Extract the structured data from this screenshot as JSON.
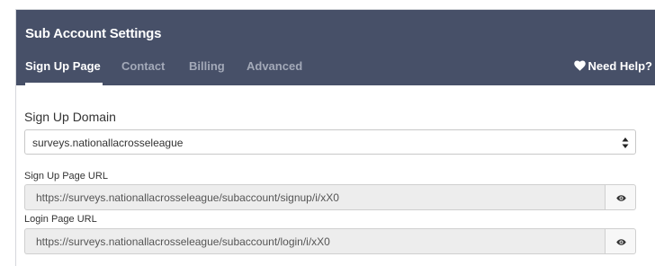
{
  "panel": {
    "title": "Sub Account Settings",
    "tabs": [
      {
        "label": "Sign Up Page",
        "active": true
      },
      {
        "label": "Contact",
        "active": false
      },
      {
        "label": "Billing",
        "active": false
      },
      {
        "label": "Advanced",
        "active": false
      }
    ],
    "help_label": "Need Help?",
    "help_icon": "heart-icon",
    "header_color": "#475068"
  },
  "signup_domain": {
    "label": "Sign Up Domain",
    "selected": "surveys.nationallacrosseleague"
  },
  "signup_url": {
    "label": "Sign Up Page URL",
    "value": "https://surveys.nationallacrosseleague/subaccount/signup/i/xX0",
    "button_icon": "eye-icon"
  },
  "login_url": {
    "label": "Login Page URL",
    "value": "https://surveys.nationallacrosseleague/subaccount/login/i/xX0",
    "button_icon": "eye-icon"
  }
}
